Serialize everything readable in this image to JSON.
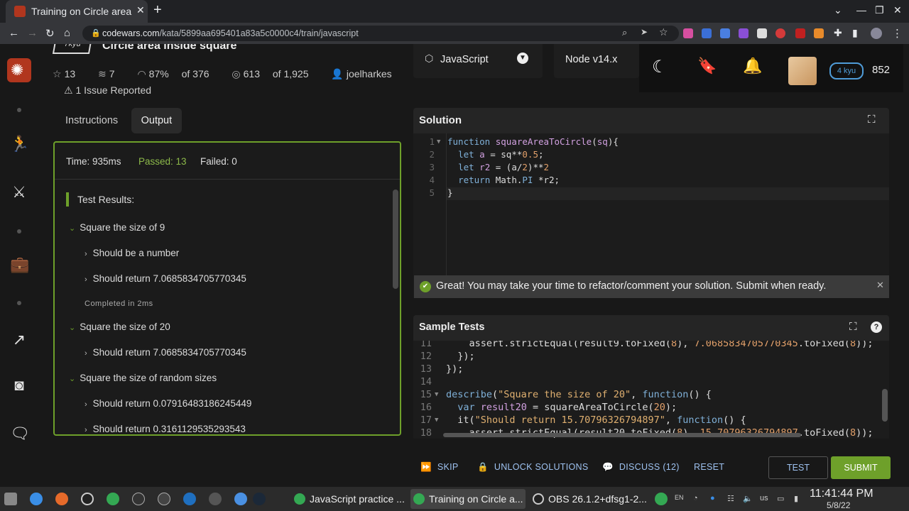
{
  "browser": {
    "tab_title": "Training on Circle area",
    "url_host": "codewars.com",
    "url_path": "/kata/5899aa695401a83a5c0000c4/train/javascript"
  },
  "kata": {
    "kyu_label": "7kyu",
    "title": "Circle area inside square",
    "stats": {
      "stars": "13",
      "collections": "7",
      "satisfaction": "87%",
      "satisfaction_of": "of 376",
      "completed": "613",
      "completed_of": "of 1,925",
      "author": "joelharkes"
    },
    "issues": "1 Issue Reported"
  },
  "tabs": [
    "Instructions",
    "Output"
  ],
  "output": {
    "time": "Time: 935ms",
    "passed": "Passed: 13",
    "failed": "Failed: 0",
    "results_heading": "Test Results:",
    "items": [
      {
        "label": "Square the size of 9"
      },
      {
        "label": "Should be a number"
      },
      {
        "label": "Should return 7.0685834705770345"
      },
      {
        "label": "Completed in 2ms"
      },
      {
        "label": "Square the size of 20"
      },
      {
        "label": "Should return 7.0685834705770345"
      },
      {
        "label": "Square the size of random sizes"
      },
      {
        "label": "Should return 0.07916483186245449"
      },
      {
        "label": "Should return 0.3161129535293543"
      }
    ]
  },
  "toolbar": {
    "language": "JavaScript",
    "version": "Node v14.x",
    "rank": "4 kyu",
    "honor": "852"
  },
  "solution": {
    "heading": "Solution",
    "lines": [
      {
        "n": "1",
        "text": "function squareAreaToCircle(sq){"
      },
      {
        "n": "2",
        "text": "  let a = sq**0.5;"
      },
      {
        "n": "3",
        "text": "  let r2 = (a/2)**2"
      },
      {
        "n": "4",
        "text": "  return Math.PI *r2;"
      },
      {
        "n": "5",
        "text": "}"
      }
    ]
  },
  "alert": "Great! You may take your time to refactor/comment your solution. Submit when ready.",
  "sample_tests": {
    "heading": "Sample Tests",
    "lines": [
      {
        "n": "11",
        "text": "    assert.strictEqual(result9.toFixed(8), 7.0685834705770345.toFixed(8));"
      },
      {
        "n": "12",
        "text": "  });"
      },
      {
        "n": "13",
        "text": "});"
      },
      {
        "n": "14",
        "text": ""
      },
      {
        "n": "15",
        "text": "describe(\"Square the size of 20\", function() {"
      },
      {
        "n": "16",
        "text": "  var result20 = squareAreaToCircle(20);"
      },
      {
        "n": "17",
        "text": "  it(\"Should return 15.70796326794897\", function() {"
      },
      {
        "n": "18",
        "text": "    assert.strictEqual(result20.toFixed(8), 15.70796326794897.toFixed(8));"
      }
    ]
  },
  "actions": {
    "skip": "SKIP",
    "unlock": "UNLOCK SOLUTIONS",
    "discuss": "DISCUSS (12)",
    "reset": "RESET",
    "test": "TEST",
    "submit": "SUBMIT"
  },
  "taskbar": {
    "windows": [
      "JavaScript practice ...",
      "Training on Circle a...",
      "OBS 26.1.2+dfsg1-2..."
    ],
    "lang": "EN",
    "kb": "us",
    "time": "11:41:44 PM",
    "date": "5/8/22"
  }
}
